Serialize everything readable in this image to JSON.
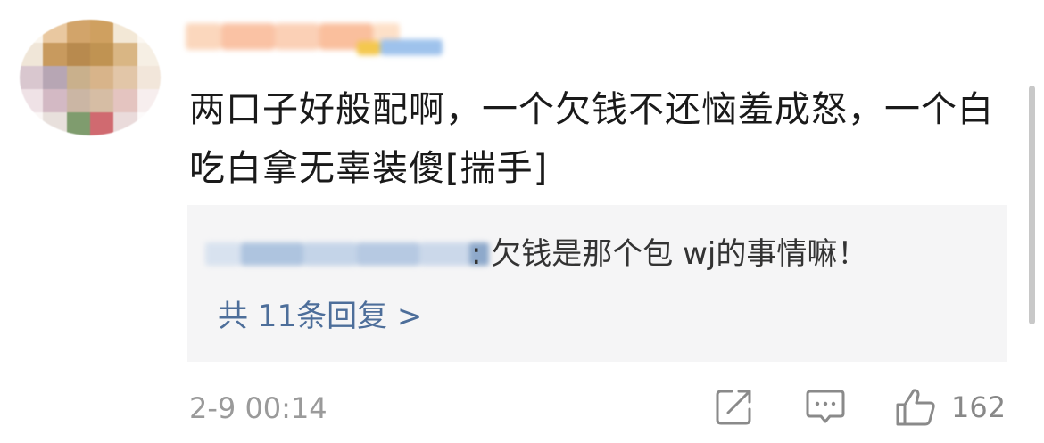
{
  "comment": {
    "text": "两口子好般配啊，一个欠钱不还恼羞成怒，一个白吃白拿无辜装傻[揣手]",
    "timestamp": "2-9 00:14"
  },
  "reply": {
    "text": ": 欠钱是那个包 wj的事情嘛！",
    "more_label": "共 11条回复 >"
  },
  "actions": {
    "share_icon": "share-icon",
    "comment_icon": "comment-icon",
    "like_icon": "thumbs-up-icon",
    "like_count": "162"
  },
  "colors": {
    "link": "#4d6e9a",
    "text": "#1a1a1a",
    "muted": "#9a9a9a",
    "reply_bg": "#f5f5f6"
  }
}
